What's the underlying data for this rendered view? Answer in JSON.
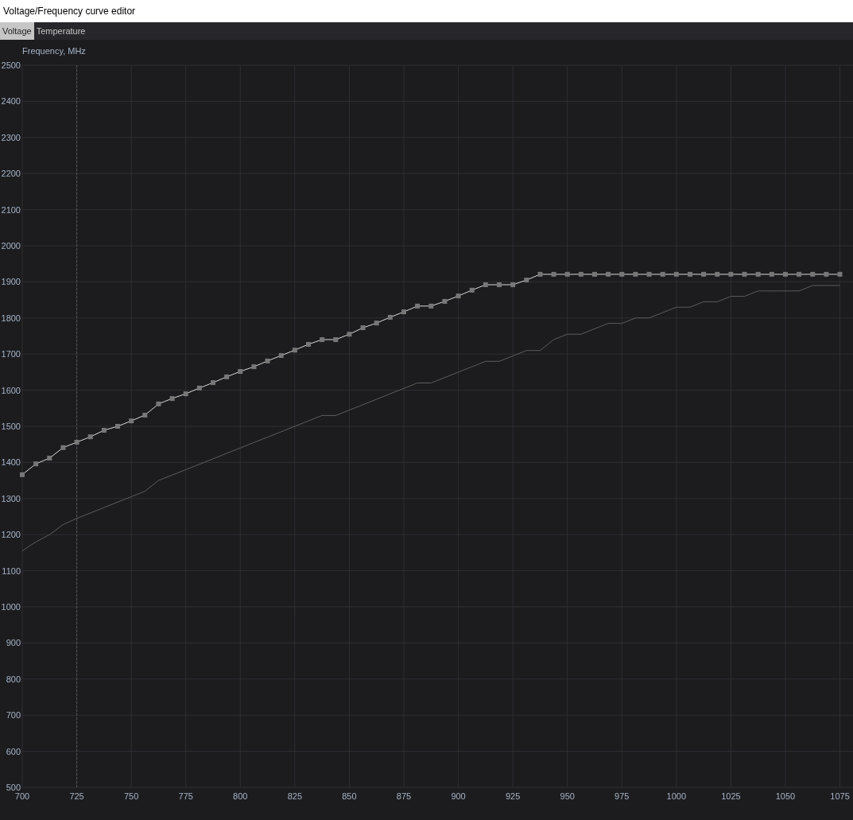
{
  "window": {
    "title": "Voltage/Frequency curve editor"
  },
  "tabs": [
    {
      "label": "Voltage",
      "selected": true
    },
    {
      "label": "Temperature",
      "selected": false
    }
  ],
  "chart": {
    "chart_data": {
      "type": "line",
      "ylabel": "Frequency, MHz",
      "x": [
        700,
        706.25,
        712.5,
        718.75,
        725,
        731.25,
        737.5,
        743.75,
        750,
        756.25,
        762.5,
        768.75,
        775,
        781.25,
        787.5,
        793.75,
        800,
        806.25,
        812.5,
        818.75,
        825,
        831.25,
        837.5,
        843.75,
        850,
        856.25,
        862.5,
        868.75,
        875,
        881.25,
        887.5,
        893.75,
        900,
        906.25,
        912.5,
        918.75,
        925,
        931.25,
        937.5,
        943.75,
        950,
        956.25,
        962.5,
        968.75,
        975,
        981.25,
        987.5,
        993.75,
        1000,
        1006.25,
        1012.5,
        1018.75,
        1025,
        1031.25,
        1037.5,
        1043.75,
        1050,
        1056.25,
        1062.5,
        1068.75,
        1075
      ],
      "series": [
        {
          "color": "#d9d9d9",
          "marker": "square",
          "values": [
            1366,
            1396,
            1412,
            1441,
            1456,
            1471,
            1489,
            1500,
            1515,
            1531,
            1562,
            1577,
            1590,
            1606,
            1621,
            1637,
            1652,
            1665,
            1681,
            1696,
            1711,
            1727,
            1740,
            1740,
            1755,
            1773,
            1786,
            1802,
            1817,
            1833,
            1833,
            1846,
            1861,
            1877,
            1892,
            1892,
            1892,
            1905,
            1921,
            1921,
            1921,
            1921,
            1921,
            1921,
            1921,
            1921,
            1921,
            1921,
            1921,
            1921,
            1921,
            1921,
            1921,
            1921,
            1921,
            1921,
            1921,
            1921,
            1921,
            1921,
            1921
          ]
        },
        {
          "color": "#5c5c5c",
          "values": [
            1155,
            1180,
            1200,
            1228,
            1245,
            1260,
            1275,
            1290,
            1305,
            1320,
            1350,
            1365,
            1380,
            1395,
            1410,
            1425,
            1440,
            1455,
            1470,
            1485,
            1500,
            1515,
            1530,
            1530,
            1545,
            1560,
            1575,
            1590,
            1605,
            1620,
            1620,
            1635,
            1650,
            1665,
            1680,
            1680,
            1695,
            1710,
            1710,
            1740,
            1755,
            1755,
            1770,
            1785,
            1785,
            1800,
            1800,
            1815,
            1830,
            1830,
            1845,
            1845,
            1860,
            1860,
            1875,
            1875,
            1875,
            1875,
            1890,
            1890,
            1890
          ]
        }
      ],
      "xlim": [
        700,
        1081
      ],
      "ylim": [
        500,
        2500
      ],
      "xticks": [
        700,
        725,
        750,
        775,
        800,
        825,
        850,
        875,
        900,
        925,
        950,
        975,
        1000,
        1025,
        1050,
        1075
      ],
      "yticks": [
        500,
        600,
        700,
        800,
        900,
        1000,
        1100,
        1200,
        1300,
        1400,
        1500,
        1600,
        1700,
        1800,
        1900,
        2000,
        2100,
        2200,
        2300,
        2400,
        2500
      ],
      "grid": true,
      "ref_lines": [
        {
          "axis": "x",
          "value": 725
        }
      ]
    }
  }
}
